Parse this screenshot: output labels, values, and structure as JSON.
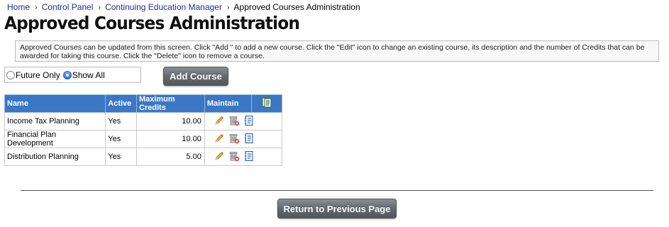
{
  "breadcrumb": {
    "home": "Home",
    "control_panel": "Control Panel",
    "ce_manager": "Continuing Education Manager",
    "current": "Approved Courses Administration",
    "separator": "›"
  },
  "page": {
    "title": "Approved Courses Administration",
    "instructions": "Approved Courses can be updated from this screen. Click \"Add \" to add a new course. Click the \"Edit\" icon to change an existing course, its description and the number of Credits that can be awarded for taking this course. Click the \"Delete\" icon to remove a course."
  },
  "filter": {
    "options": [
      {
        "label": "Future Only",
        "selected": false
      },
      {
        "label": "Show All",
        "selected": true
      }
    ]
  },
  "buttons": {
    "add_course": "Add Course",
    "return": "Return to Previous Page"
  },
  "table": {
    "headers": {
      "name": "Name",
      "active": "Active",
      "max_credits": "Maximum Credits",
      "maintain": "Maintain"
    },
    "header_icon": "report-icon",
    "row_icons": [
      "pencil-edit-icon",
      "trash-delete-icon",
      "notebook-details-icon"
    ],
    "rows": [
      {
        "name": "Income Tax Planning",
        "active": "Yes",
        "max_credits": "10.00"
      },
      {
        "name": "Financial Plan Development",
        "active": "Yes",
        "max_credits": "10.00"
      },
      {
        "name": "Distribution Planning",
        "active": "Yes",
        "max_credits": "5.00"
      }
    ]
  },
  "colors": {
    "header_bg": "#3b77c5",
    "link": "#1a2f9a",
    "button_bg": "#63676c"
  }
}
